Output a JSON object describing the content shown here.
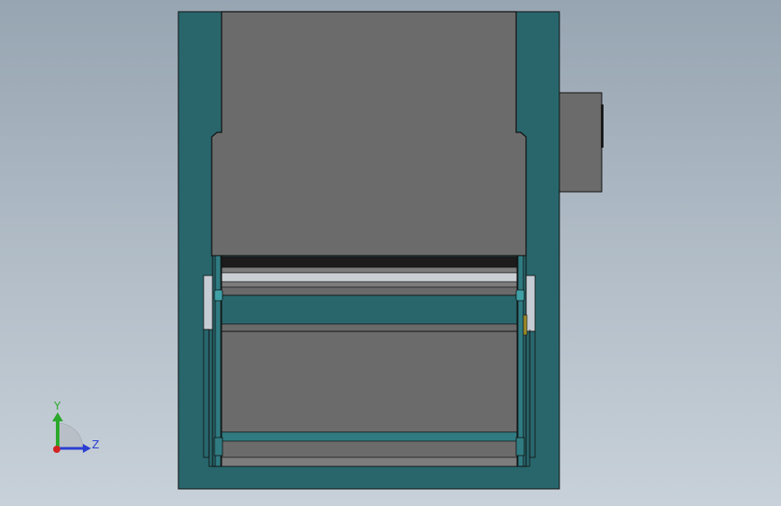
{
  "viewport": {
    "background_top": "#97a5b2",
    "background_bottom": "#c8d1d9"
  },
  "colors": {
    "housing": "#28666c",
    "panel_grey": "#6b6b6b",
    "edge": "#111111",
    "light_part": "#c5ccd3",
    "teal_part": "#2f7b81"
  },
  "triad": {
    "x_label": "",
    "y_label": "Y",
    "z_label": "Z",
    "y_color": "#2ba82b",
    "z_color": "#2b3fd1",
    "origin_color": "#d22222"
  }
}
